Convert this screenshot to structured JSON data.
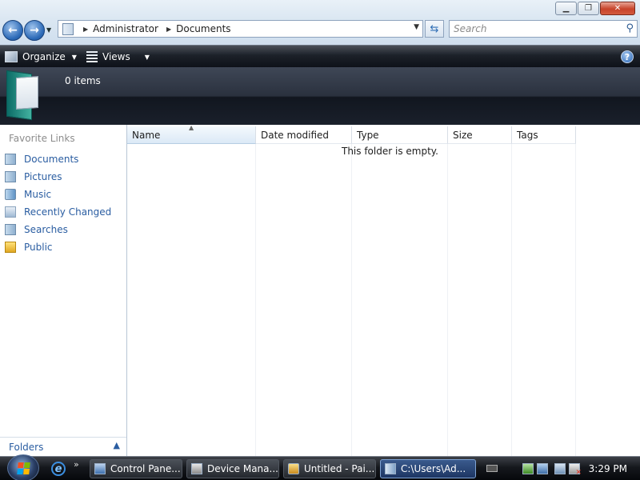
{
  "address": {
    "crumbs": [
      "Administrator",
      "Documents"
    ]
  },
  "search": {
    "placeholder": "Search"
  },
  "toolbar": {
    "organize_label": "Organize",
    "views_label": "Views"
  },
  "details": {
    "item_count": "0 items"
  },
  "nav": {
    "heading": "Favorite Links",
    "items": [
      {
        "label": "Documents",
        "icon": "documents-icon"
      },
      {
        "label": "Pictures",
        "icon": "pictures-icon"
      },
      {
        "label": "Music",
        "icon": "music-icon"
      },
      {
        "label": "Recently Changed",
        "icon": "recently-changed-icon"
      },
      {
        "label": "Searches",
        "icon": "searches-icon"
      },
      {
        "label": "Public",
        "icon": "public-folder-icon"
      }
    ],
    "folders_label": "Folders"
  },
  "filelist": {
    "columns": [
      "Name",
      "Date modified",
      "Type",
      "Size",
      "Tags"
    ],
    "empty_message": "This folder is empty."
  },
  "taskbar": {
    "tasks": [
      "Control Pane...",
      "Device Mana...",
      "Untitled - Pai...",
      "C:\\Users\\Ad..."
    ],
    "active_task": "C:\\Users\\Ad...",
    "clock": "3:29 PM"
  },
  "colors": {
    "link": "#2a5da1",
    "cmdbar": "#1c2129",
    "close_button": "#c7432a",
    "taskbar": "#15181d"
  }
}
